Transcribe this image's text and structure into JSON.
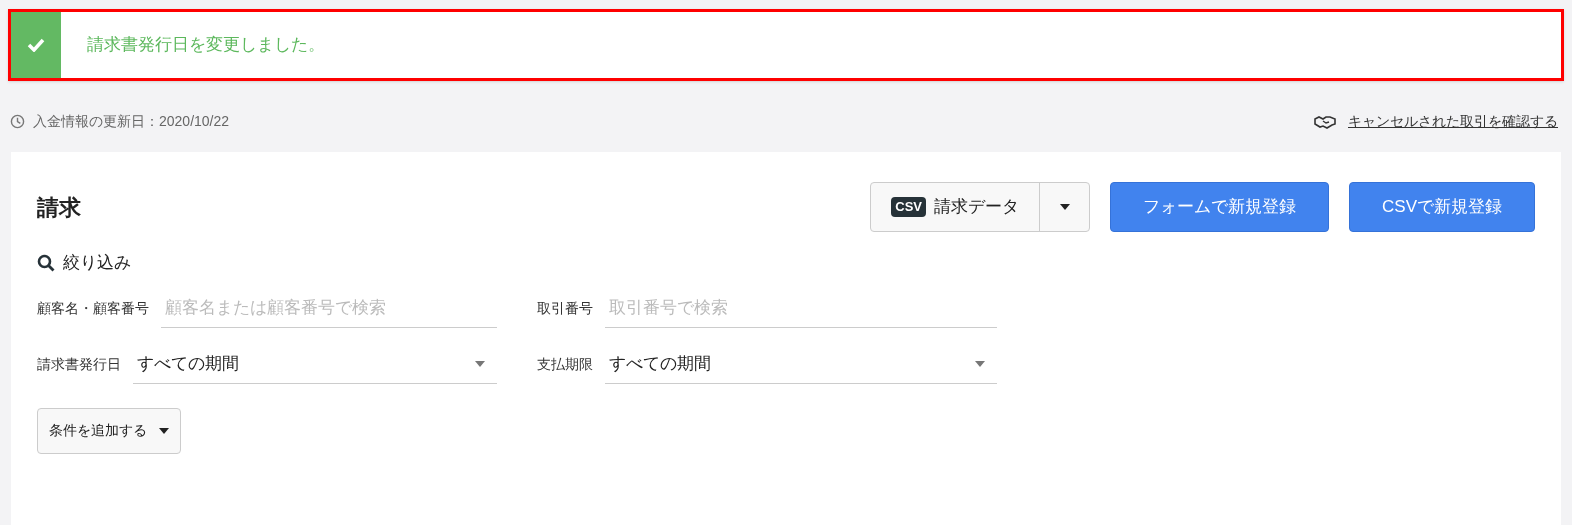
{
  "alert": {
    "message": "請求書発行日を変更しました。"
  },
  "update_info": {
    "text": "入金情報の更新日：2020/10/22"
  },
  "cancel_link": {
    "text": "キャンセルされた取引を確認する"
  },
  "panel": {
    "title": "請求",
    "csv_button": {
      "badge": "CSV",
      "label": "請求データ"
    },
    "buttons": [
      "フォームで新規登録",
      "CSVで新規登録"
    ],
    "filter": {
      "title": "絞り込み",
      "fields": [
        {
          "kind": "text",
          "label": "顧客名・顧客番号",
          "placeholder": "顧客名または顧客番号で検索"
        },
        {
          "kind": "text",
          "label": "取引番号",
          "placeholder": "取引番号で検索"
        },
        {
          "kind": "select",
          "label": "請求書発行日",
          "value": "すべての期間"
        },
        {
          "kind": "select",
          "label": "支払期限",
          "value": "すべての期間"
        }
      ],
      "add_condition": "条件を追加する"
    }
  }
}
